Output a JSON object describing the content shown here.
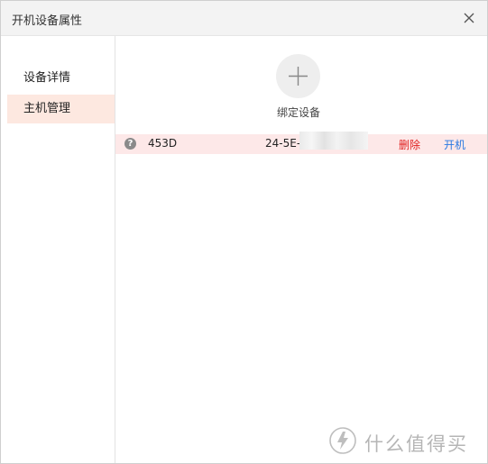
{
  "window": {
    "title": "开机设备属性"
  },
  "sidebar": {
    "items": [
      {
        "label": "设备详情",
        "active": false
      },
      {
        "label": "主机管理",
        "active": true
      }
    ]
  },
  "main": {
    "add_device_label": "绑定设备",
    "devices": [
      {
        "name": "453D",
        "mac_prefix": "24-5E-",
        "delete_label": "删除",
        "power_on_label": "开机"
      }
    ]
  },
  "watermark": {
    "text": "什么值得买"
  },
  "colors": {
    "active_sidebar_bg": "#fde8e0",
    "row_highlight_bg": "#fde8e8",
    "delete_red": "#e02020",
    "power_on_blue": "#2a7ae2"
  },
  "icons": {
    "close": "close-icon",
    "add": "plus-icon",
    "help": "question-mark-icon"
  }
}
